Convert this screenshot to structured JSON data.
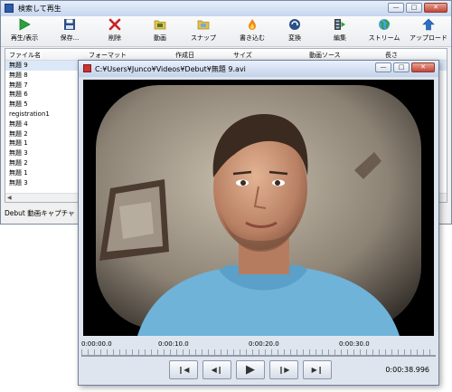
{
  "main_window": {
    "title": "検索して再生",
    "controls": {
      "minimize": "—",
      "maximize": "□",
      "close": "✕"
    }
  },
  "toolbar": {
    "buttons": [
      {
        "label": "再生/表示",
        "icon": "play-icon",
        "color": "#2aa33a"
      },
      {
        "label": "保存...",
        "icon": "floppy-icon",
        "color": "#2c4f86"
      },
      {
        "label": "削除",
        "icon": "delete-x-icon",
        "color": "#cc2222"
      },
      {
        "label": "動画",
        "icon": "video-folder-icon",
        "color": "#d9b233"
      },
      {
        "label": "スナップ",
        "icon": "snapshot-folder-icon",
        "color": "#d9b233"
      },
      {
        "label": "書き込む",
        "icon": "burn-flame-icon",
        "color": "#f08a1c"
      },
      {
        "label": "変換",
        "icon": "convert-icon",
        "color": "#2c4f86"
      },
      {
        "label": "編集",
        "icon": "edit-film-icon",
        "color": "#2aa33a"
      },
      {
        "label": "ストリーム",
        "icon": "globe-icon",
        "color": "#2aa33a"
      },
      {
        "label": "アップロード",
        "icon": "upload-arrow-icon",
        "color": "#2b6fc7"
      }
    ]
  },
  "file_list": {
    "columns": [
      "ファイル名",
      "フォーマット",
      "作成日",
      "サイズ",
      "動画ソース",
      "長さ"
    ],
    "rows": [
      "無題 9",
      "無題 8",
      "無題 7",
      "無題 6",
      "無題 5",
      "registration1",
      "無題 4",
      "無題 2",
      "無題 1",
      "無題 3",
      "無題 2",
      "無題 1",
      "無題 3"
    ]
  },
  "status_bar": {
    "text": "Debut 動画キャプチャ"
  },
  "player": {
    "title": "C:¥Users¥Junco¥Videos¥Debut¥無題 9.avi",
    "timeline_labels": [
      "0:00:00.0",
      "0:00:10.0",
      "0:00:20.0",
      "0:00:30.0"
    ],
    "buttons": [
      {
        "label": "❙◀",
        "icon": "skip-back-icon"
      },
      {
        "label": "◀❙",
        "icon": "step-back-icon"
      },
      {
        "label": "▶",
        "icon": "play-icon"
      },
      {
        "label": "❙▶",
        "icon": "step-forward-icon"
      },
      {
        "label": "▶❙",
        "icon": "skip-forward-icon"
      }
    ],
    "time": "0:00:38.996"
  }
}
